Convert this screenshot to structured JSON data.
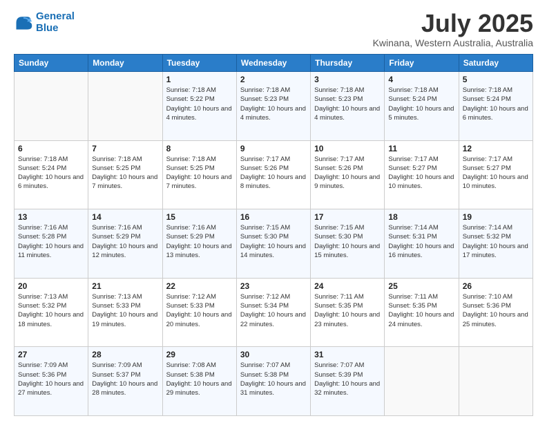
{
  "header": {
    "logo_line1": "General",
    "logo_line2": "Blue",
    "title": "July 2025",
    "subtitle": "Kwinana, Western Australia, Australia"
  },
  "weekdays": [
    "Sunday",
    "Monday",
    "Tuesday",
    "Wednesday",
    "Thursday",
    "Friday",
    "Saturday"
  ],
  "weeks": [
    [
      {
        "day": "",
        "sunrise": "",
        "sunset": "",
        "daylight": ""
      },
      {
        "day": "",
        "sunrise": "",
        "sunset": "",
        "daylight": ""
      },
      {
        "day": "1",
        "sunrise": "Sunrise: 7:18 AM",
        "sunset": "Sunset: 5:22 PM",
        "daylight": "Daylight: 10 hours and 4 minutes."
      },
      {
        "day": "2",
        "sunrise": "Sunrise: 7:18 AM",
        "sunset": "Sunset: 5:23 PM",
        "daylight": "Daylight: 10 hours and 4 minutes."
      },
      {
        "day": "3",
        "sunrise": "Sunrise: 7:18 AM",
        "sunset": "Sunset: 5:23 PM",
        "daylight": "Daylight: 10 hours and 4 minutes."
      },
      {
        "day": "4",
        "sunrise": "Sunrise: 7:18 AM",
        "sunset": "Sunset: 5:24 PM",
        "daylight": "Daylight: 10 hours and 5 minutes."
      },
      {
        "day": "5",
        "sunrise": "Sunrise: 7:18 AM",
        "sunset": "Sunset: 5:24 PM",
        "daylight": "Daylight: 10 hours and 6 minutes."
      }
    ],
    [
      {
        "day": "6",
        "sunrise": "Sunrise: 7:18 AM",
        "sunset": "Sunset: 5:24 PM",
        "daylight": "Daylight: 10 hours and 6 minutes."
      },
      {
        "day": "7",
        "sunrise": "Sunrise: 7:18 AM",
        "sunset": "Sunset: 5:25 PM",
        "daylight": "Daylight: 10 hours and 7 minutes."
      },
      {
        "day": "8",
        "sunrise": "Sunrise: 7:18 AM",
        "sunset": "Sunset: 5:25 PM",
        "daylight": "Daylight: 10 hours and 7 minutes."
      },
      {
        "day": "9",
        "sunrise": "Sunrise: 7:17 AM",
        "sunset": "Sunset: 5:26 PM",
        "daylight": "Daylight: 10 hours and 8 minutes."
      },
      {
        "day": "10",
        "sunrise": "Sunrise: 7:17 AM",
        "sunset": "Sunset: 5:26 PM",
        "daylight": "Daylight: 10 hours and 9 minutes."
      },
      {
        "day": "11",
        "sunrise": "Sunrise: 7:17 AM",
        "sunset": "Sunset: 5:27 PM",
        "daylight": "Daylight: 10 hours and 10 minutes."
      },
      {
        "day": "12",
        "sunrise": "Sunrise: 7:17 AM",
        "sunset": "Sunset: 5:27 PM",
        "daylight": "Daylight: 10 hours and 10 minutes."
      }
    ],
    [
      {
        "day": "13",
        "sunrise": "Sunrise: 7:16 AM",
        "sunset": "Sunset: 5:28 PM",
        "daylight": "Daylight: 10 hours and 11 minutes."
      },
      {
        "day": "14",
        "sunrise": "Sunrise: 7:16 AM",
        "sunset": "Sunset: 5:29 PM",
        "daylight": "Daylight: 10 hours and 12 minutes."
      },
      {
        "day": "15",
        "sunrise": "Sunrise: 7:16 AM",
        "sunset": "Sunset: 5:29 PM",
        "daylight": "Daylight: 10 hours and 13 minutes."
      },
      {
        "day": "16",
        "sunrise": "Sunrise: 7:15 AM",
        "sunset": "Sunset: 5:30 PM",
        "daylight": "Daylight: 10 hours and 14 minutes."
      },
      {
        "day": "17",
        "sunrise": "Sunrise: 7:15 AM",
        "sunset": "Sunset: 5:30 PM",
        "daylight": "Daylight: 10 hours and 15 minutes."
      },
      {
        "day": "18",
        "sunrise": "Sunrise: 7:14 AM",
        "sunset": "Sunset: 5:31 PM",
        "daylight": "Daylight: 10 hours and 16 minutes."
      },
      {
        "day": "19",
        "sunrise": "Sunrise: 7:14 AM",
        "sunset": "Sunset: 5:32 PM",
        "daylight": "Daylight: 10 hours and 17 minutes."
      }
    ],
    [
      {
        "day": "20",
        "sunrise": "Sunrise: 7:13 AM",
        "sunset": "Sunset: 5:32 PM",
        "daylight": "Daylight: 10 hours and 18 minutes."
      },
      {
        "day": "21",
        "sunrise": "Sunrise: 7:13 AM",
        "sunset": "Sunset: 5:33 PM",
        "daylight": "Daylight: 10 hours and 19 minutes."
      },
      {
        "day": "22",
        "sunrise": "Sunrise: 7:12 AM",
        "sunset": "Sunset: 5:33 PM",
        "daylight": "Daylight: 10 hours and 20 minutes."
      },
      {
        "day": "23",
        "sunrise": "Sunrise: 7:12 AM",
        "sunset": "Sunset: 5:34 PM",
        "daylight": "Daylight: 10 hours and 22 minutes."
      },
      {
        "day": "24",
        "sunrise": "Sunrise: 7:11 AM",
        "sunset": "Sunset: 5:35 PM",
        "daylight": "Daylight: 10 hours and 23 minutes."
      },
      {
        "day": "25",
        "sunrise": "Sunrise: 7:11 AM",
        "sunset": "Sunset: 5:35 PM",
        "daylight": "Daylight: 10 hours and 24 minutes."
      },
      {
        "day": "26",
        "sunrise": "Sunrise: 7:10 AM",
        "sunset": "Sunset: 5:36 PM",
        "daylight": "Daylight: 10 hours and 25 minutes."
      }
    ],
    [
      {
        "day": "27",
        "sunrise": "Sunrise: 7:09 AM",
        "sunset": "Sunset: 5:36 PM",
        "daylight": "Daylight: 10 hours and 27 minutes."
      },
      {
        "day": "28",
        "sunrise": "Sunrise: 7:09 AM",
        "sunset": "Sunset: 5:37 PM",
        "daylight": "Daylight: 10 hours and 28 minutes."
      },
      {
        "day": "29",
        "sunrise": "Sunrise: 7:08 AM",
        "sunset": "Sunset: 5:38 PM",
        "daylight": "Daylight: 10 hours and 29 minutes."
      },
      {
        "day": "30",
        "sunrise": "Sunrise: 7:07 AM",
        "sunset": "Sunset: 5:38 PM",
        "daylight": "Daylight: 10 hours and 31 minutes."
      },
      {
        "day": "31",
        "sunrise": "Sunrise: 7:07 AM",
        "sunset": "Sunset: 5:39 PM",
        "daylight": "Daylight: 10 hours and 32 minutes."
      },
      {
        "day": "",
        "sunrise": "",
        "sunset": "",
        "daylight": ""
      },
      {
        "day": "",
        "sunrise": "",
        "sunset": "",
        "daylight": ""
      }
    ]
  ]
}
